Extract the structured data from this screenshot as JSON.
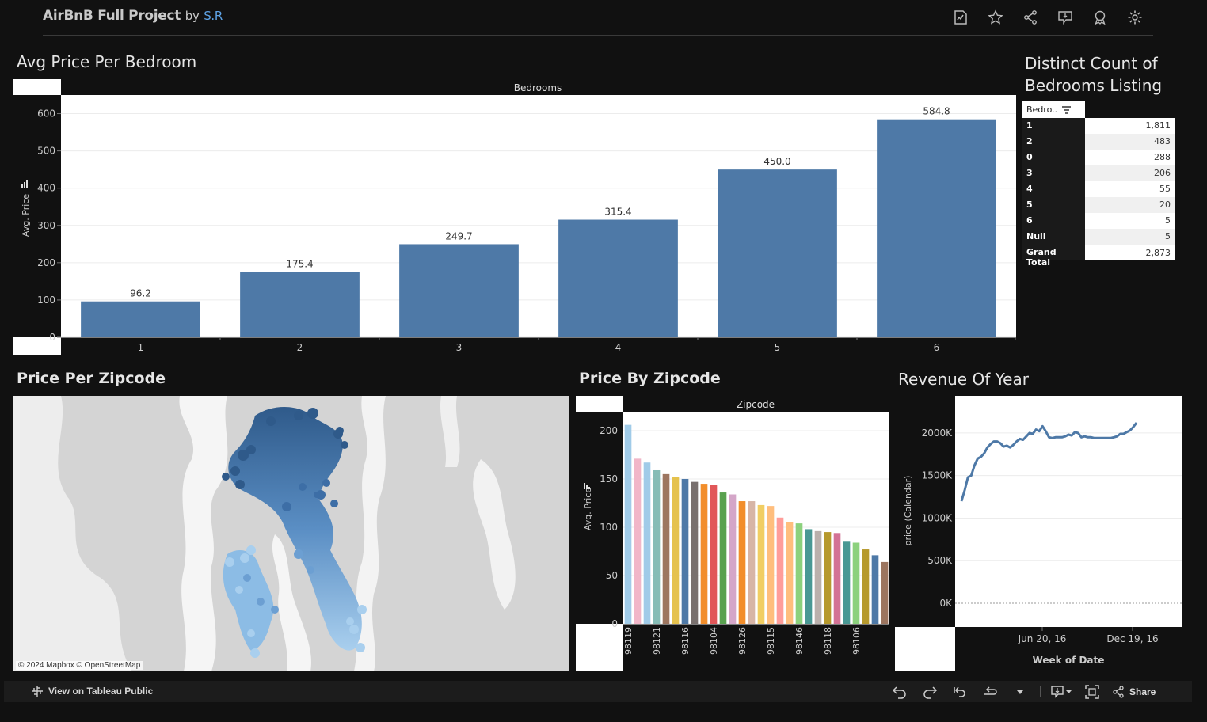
{
  "header": {
    "title": "AirBnB Full Project",
    "by": "by",
    "author": "S.R"
  },
  "toolbar_icons": [
    "request-access-icon",
    "star-icon",
    "share-icon",
    "comment-icon",
    "badge-icon",
    "gear-icon"
  ],
  "sections": {
    "avg_price_title": "Avg Price Per Bedroom",
    "distinct_title_line1": "Distinct Count of",
    "distinct_title_line2": "Bedrooms Listing",
    "map_title": "Price Per Zipcode",
    "zip_title": "Price By Zipcode",
    "revenue_title": "Revenue Of Year"
  },
  "chart_data": [
    {
      "type": "bar",
      "title": "Avg Price Per Bedroom",
      "header": "Bedrooms",
      "categories": [
        "1",
        "2",
        "3",
        "4",
        "5",
        "6"
      ],
      "values": [
        96.2,
        175.4,
        249.7,
        315.4,
        450.0,
        584.8
      ],
      "value_labels": [
        "96.2",
        "175.4",
        "249.7",
        "315.4",
        "450.0",
        "584.8"
      ],
      "ylabel": "Avg. Price",
      "yticks": [
        0,
        100,
        200,
        300,
        400,
        500,
        600
      ],
      "ylim": [
        0,
        650
      ],
      "color": "#4e79a7",
      "grid": true
    },
    {
      "type": "bar",
      "title": "Price By Zipcode",
      "header": "Zipcode",
      "ylabel": "Avg. Price",
      "yticks": [
        0,
        50,
        100,
        150,
        200
      ],
      "ylim": [
        0,
        218
      ],
      "values": [
        206,
        171,
        167,
        159,
        155,
        152,
        150,
        147,
        145,
        144,
        136,
        134,
        127,
        127,
        123,
        122,
        110,
        105,
        104,
        98,
        96,
        95,
        94,
        85,
        84,
        77,
        71,
        64
      ],
      "colors": [
        "#a0cbe8",
        "#f1b6c8",
        "#a0cbe8",
        "#86bcb6",
        "#9d7660",
        "#e5c24d",
        "#4e79a7",
        "#79706e",
        "#f28e2b",
        "#e15759",
        "#59a14f",
        "#d4a6c8",
        "#f28e2b",
        "#d7b5a6",
        "#f1ce63",
        "#ffbe7d",
        "#ff9d9a",
        "#ffbe7d",
        "#8cd17d",
        "#499894",
        "#bab0ac",
        "#b6992d",
        "#d37295",
        "#499894",
        "#8cd17d",
        "#b6992d",
        "#4e79a7",
        "#9c755f"
      ],
      "tick_labels": [
        "98119",
        "98121",
        "98116",
        "98104",
        "98126",
        "98115",
        "98146",
        "98118",
        "98106"
      ]
    },
    {
      "type": "line",
      "title": "Revenue Of Year",
      "xlabel": "Week of Date",
      "ylabel": "price (Calendar)",
      "yticks": [
        "0K",
        "500K",
        "1000K",
        "1500K",
        "2000K"
      ],
      "ylim": [
        0,
        2250000
      ],
      "xticks": [
        "Jun 20, 16",
        "Dec 19, 16"
      ],
      "color": "#4e79a7",
      "values": [
        1200000,
        1330000,
        1480000,
        1500000,
        1620000,
        1700000,
        1720000,
        1760000,
        1830000,
        1870000,
        1900000,
        1900000,
        1880000,
        1840000,
        1850000,
        1830000,
        1860000,
        1900000,
        1930000,
        1920000,
        1960000,
        2000000,
        1990000,
        2040000,
        2020000,
        2080000,
        2020000,
        1950000,
        1940000,
        1950000,
        1950000,
        1950000,
        1960000,
        1980000,
        1970000,
        2010000,
        2000000,
        1950000,
        1960000,
        1950000,
        1950000,
        1940000,
        1940000,
        1940000,
        1940000,
        1940000,
        1940000,
        1950000,
        1960000,
        1990000,
        1990000,
        2010000,
        2030000,
        2070000,
        2120000
      ]
    }
  ],
  "table": {
    "header": "Bedro..",
    "rows": [
      {
        "k": "1",
        "v": "1,811"
      },
      {
        "k": "2",
        "v": "483"
      },
      {
        "k": "0",
        "v": "288"
      },
      {
        "k": "3",
        "v": "206"
      },
      {
        "k": "4",
        "v": "55"
      },
      {
        "k": "5",
        "v": "20"
      },
      {
        "k": "6",
        "v": "5"
      },
      {
        "k": "Null",
        "v": "5"
      }
    ],
    "total_label": "Grand Total",
    "total_value": "2,873"
  },
  "map": {
    "attribution": "© 2024 Mapbox  © OpenStreetMap"
  },
  "footer": {
    "view_label": "View on Tableau Public",
    "share_label": "Share"
  }
}
